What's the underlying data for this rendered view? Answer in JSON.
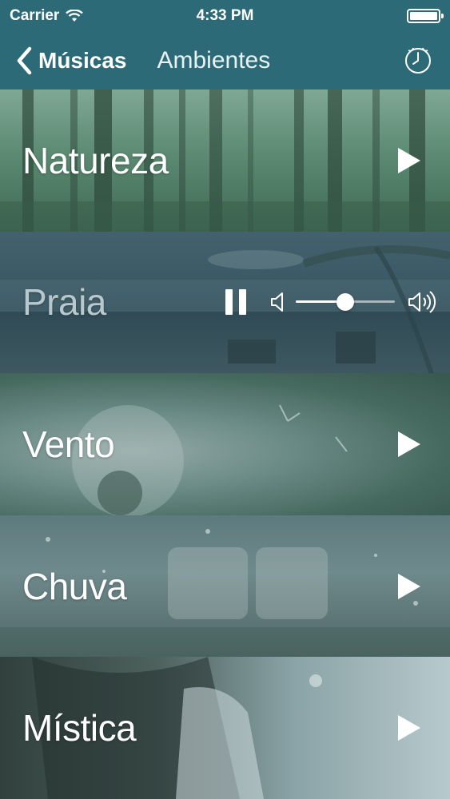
{
  "status": {
    "carrier": "Carrier",
    "time": "4:33 PM",
    "battery_icon": "battery-full-icon",
    "wifi_icon": "wifi-icon"
  },
  "nav": {
    "back_label": "Músicas",
    "title": "Ambientes",
    "timer_icon": "clock-icon",
    "bar_color": "#2c6a78"
  },
  "rows": [
    {
      "label": "Natureza",
      "state": "stopped",
      "icon": "play-icon"
    },
    {
      "label": "Praia",
      "state": "playing",
      "icon": "pause-icon",
      "volume": 0.5
    },
    {
      "label": "Vento",
      "state": "stopped",
      "icon": "play-icon"
    },
    {
      "label": "Chuva",
      "state": "stopped",
      "icon": "play-icon"
    },
    {
      "label": "Mística",
      "state": "stopped",
      "icon": "play-icon"
    }
  ]
}
